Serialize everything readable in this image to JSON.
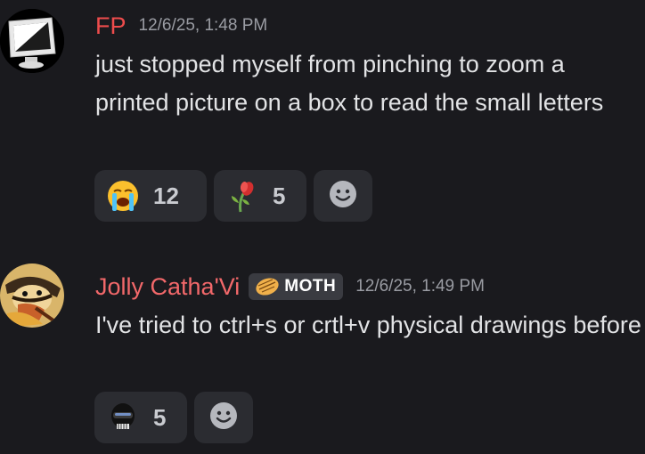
{
  "messages": [
    {
      "username": "FP",
      "timestamp": "12/6/25, 1:48 PM",
      "text": "just stopped myself from pinching to zoom a printed picture on a box to read the small letters",
      "avatar_icon": "computer-monitor-icon",
      "reactions": [
        {
          "emoji": "loudly-crying-face-icon",
          "count": "12"
        },
        {
          "emoji": "wilted-flower-icon",
          "count": "5"
        }
      ],
      "add_reaction_icon": "smiley-add-reaction-icon"
    },
    {
      "username": "Jolly Catha'Vi",
      "tag": {
        "icon": "moth-badge-icon",
        "label": "MOTH"
      },
      "timestamp": "12/6/25, 1:49 PM",
      "text": "I've tried to ctrl+s or crtl+v physical drawings before",
      "avatar_icon": "cartoon-character-avatar",
      "reactions": [
        {
          "emoji": "black-helmet-skull-icon",
          "count": "5"
        }
      ],
      "add_reaction_icon": "smiley-add-reaction-icon"
    }
  ],
  "colors": {
    "background": "#1a1a1e",
    "fp_name": "#ee4c4c",
    "jolly_name": "#f2686a",
    "timestamp": "#9a9ca3",
    "reaction_bg": "#2b2c31"
  }
}
